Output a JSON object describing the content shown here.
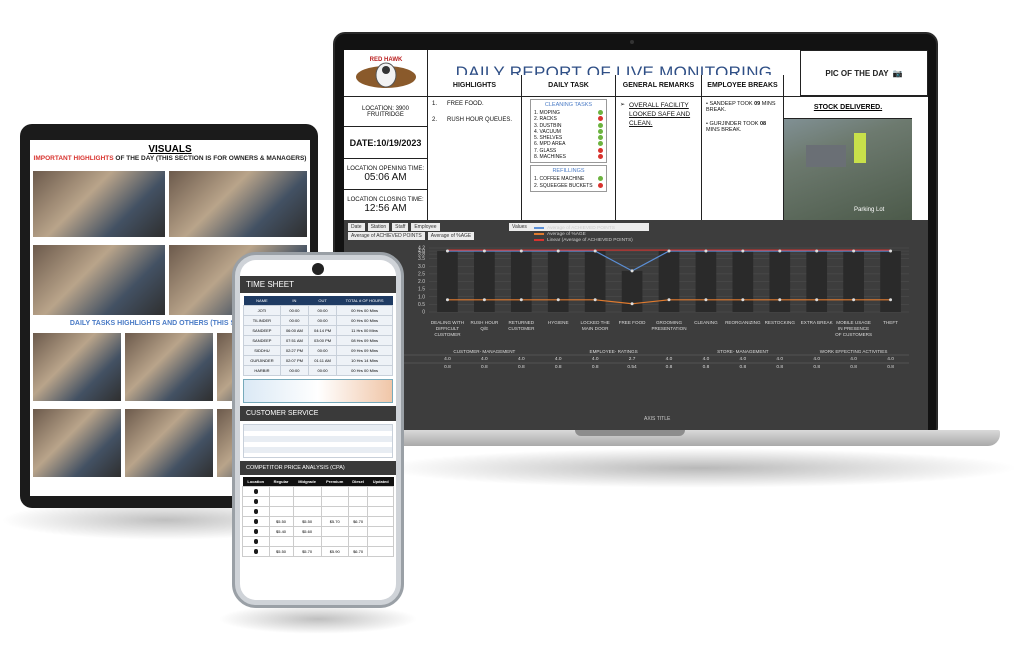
{
  "laptop": {
    "brand": "RED HAWK",
    "title": "DAILY REPORT OF LIVE MONITORING",
    "pic_of_day": "PIC OF THE DAY",
    "location": "LOCATION: 3900 FRUITRIDGE",
    "date": "DATE:10/19/2023",
    "opening_label": "LOCATION OPENING TIME:",
    "opening_time": "05:06 AM",
    "closing_label": "LOCATION CLOSING TIME:",
    "closing_time": "12:56 AM",
    "headers": {
      "highlights": "HIGHLIGHTS",
      "daily_task": "DAILY TASK",
      "remarks": "GENERAL REMARKS",
      "breaks": "EMPLOYEE BREAKS"
    },
    "highlights": [
      {
        "num": "1.",
        "text": "FREE FOOD."
      },
      {
        "num": "2.",
        "text": "RUSH HOUR QUEUES."
      }
    ],
    "cleaning_title": "CLEANING TASKS",
    "cleaning_tasks": [
      {
        "label": "1. MOPING",
        "status": "ok"
      },
      {
        "label": "2. RACKS",
        "status": "no"
      },
      {
        "label": "3. DUSTBIN",
        "status": "ok"
      },
      {
        "label": "4. VACUUM",
        "status": "ok"
      },
      {
        "label": "5. SHELVES",
        "status": "ok"
      },
      {
        "label": "6. MPD AREA",
        "status": "ok"
      },
      {
        "label": "7. GLASS",
        "status": "no"
      },
      {
        "label": "8. MACHINES",
        "status": "no"
      }
    ],
    "refilling_title": "REFILLINGS",
    "refilling_tasks": [
      {
        "label": "1. COFFEE MACHINE",
        "status": "ok"
      },
      {
        "label": "2. SQUEEGEE BUCKETS",
        "status": "no"
      }
    ],
    "remark": "OVERALL FACILITY LOOKED SAFE AND CLEAN.",
    "breaks": [
      {
        "pre": "SANDEEP TOOK ",
        "mins": "09",
        "post": " MINS BREAK."
      },
      {
        "pre": "GURJINDER TOOK ",
        "mins": "08",
        "post": " MINS BREAK."
      }
    ],
    "stock": "STOCK DELIVERED.",
    "photo_caption": "Parking Lot",
    "filters": [
      "Date",
      "Station",
      "Staff",
      "Employee"
    ],
    "values_label": "Values",
    "metric_tags": [
      "Average of ACHIEVED POINTS",
      "Average of %AGE"
    ],
    "legend": [
      "Average of ACHIEVED POINTS",
      "Average of %AGE",
      "Linear (Average of ACHIEVED POINTS)"
    ],
    "axis_title": "AXIS TITLE",
    "row_labels": [
      "ACHIEVED POINTS",
      "%AGE"
    ],
    "groups": [
      "CUSTOMER- MANAGEMENT",
      "EMPLOYEE- RATINGS",
      "STORE- MANAGEMENT",
      "WORK EFFECTING ACTIVITIES"
    ]
  },
  "chart_data": {
    "type": "bar",
    "categories": [
      "DEALING WITH DIFFICULT CUSTOMER",
      "RUSH HOUR Q/E",
      "RETURNED CUSTOMER",
      "HYGIENE",
      "LOCKED THE MAIN DOOR",
      "FREE FOOD",
      "GROOMING PRESENTATION",
      "CLEANING",
      "REORGANIZING",
      "RESTOCKING",
      "EXTRA BREAK",
      "MOBILE USAGE IN PRESENCE OF CUSTOMERS",
      "THEFT"
    ],
    "series": [
      {
        "name": "Average of ACHIEVED POINTS",
        "values": [
          4.0,
          4.0,
          4.0,
          4.0,
          4.0,
          2.7,
          4.0,
          4.0,
          4.0,
          4.0,
          4.0,
          4.0,
          4.0
        ]
      },
      {
        "name": "Average of %AGE",
        "values": [
          0.8,
          0.8,
          0.8,
          0.8,
          0.8,
          0.54,
          0.8,
          0.8,
          0.8,
          0.8,
          0.8,
          0.8,
          0.8
        ]
      }
    ],
    "ylim": [
      0,
      4.2
    ],
    "yticks": [
      "4.2",
      "4.0",
      "3.8",
      "3.5",
      "3.0",
      "2.5",
      "2.0",
      "1.5",
      "1.0",
      "0.5",
      "0"
    ],
    "grid": true,
    "legend_position": "top"
  },
  "tablet": {
    "title": "VISUALS",
    "sub_red": "IMPORTANT HIGHLIGHTS",
    "sub_rest": " OF THE DAY (THIS SECTION IS FOR OWNERS & MANAGERS)",
    "mid": "DAILY TASKS HIGHLIGHTS AND OTHERS (THIS SECTION IS"
  },
  "phone": {
    "timesheet": "TIME SHEET",
    "ts_headers": [
      "NAME",
      "IN",
      "OUT",
      "TOTAL # OF HOURS"
    ],
    "ts_rows": [
      [
        "JOTI",
        "00:00",
        "00:00",
        "00 Hrs 00 Mins"
      ],
      [
        "TILINDER",
        "00:00",
        "00:00",
        "00 Hrs 00 Mins"
      ],
      [
        "SANDEEP",
        "06:00 AM",
        "04:14 PM",
        "11 Hrs 00 Mins"
      ],
      [
        "SANDEEP",
        "07:51 AM",
        "03:00 PM",
        "08 Hrs 09 Mins"
      ],
      [
        "SIDDHU",
        "02:27 PM",
        "00:00",
        "09 Hrs 09 Mins"
      ],
      [
        "GURJINDER",
        "02:07 PM",
        "01:11 AM",
        "10 Hrs 14 Mins"
      ],
      [
        "HARBIR",
        "00:00",
        "00:00",
        "00 Hrs 00 Mins"
      ]
    ],
    "customer_service": "CUSTOMER SERVICE",
    "cpa": "COMPETITOR PRICE ANALYSIS (CPA)",
    "cpa_headers": [
      "Location",
      "Regular",
      "Midgrade",
      "Premium",
      "Diesel",
      "Updated"
    ],
    "cpa_rows": [
      [
        "",
        "",
        "",
        "",
        "",
        ""
      ],
      [
        "",
        "",
        "",
        "",
        "",
        ""
      ],
      [
        "",
        "",
        "",
        "",
        "",
        ""
      ],
      [
        "",
        "$5.50",
        "$5.50",
        "$5.70",
        "$6.70",
        ""
      ],
      [
        "",
        "$5.40",
        "$5.60",
        "",
        "",
        ""
      ],
      [
        "",
        "",
        "",
        "",
        "",
        ""
      ],
      [
        "",
        "$5.50",
        "$5.70",
        "$5.90",
        "$6.70",
        ""
      ]
    ]
  },
  "colors": {
    "accent_blue": "#2f4f86",
    "ok": "#6cb33f",
    "fail": "#d8332e",
    "dash_bg": "#3d3d3d",
    "line_red": "#d8332e",
    "line_blue": "#5b8fd6",
    "line_orange": "#e07b2f"
  }
}
